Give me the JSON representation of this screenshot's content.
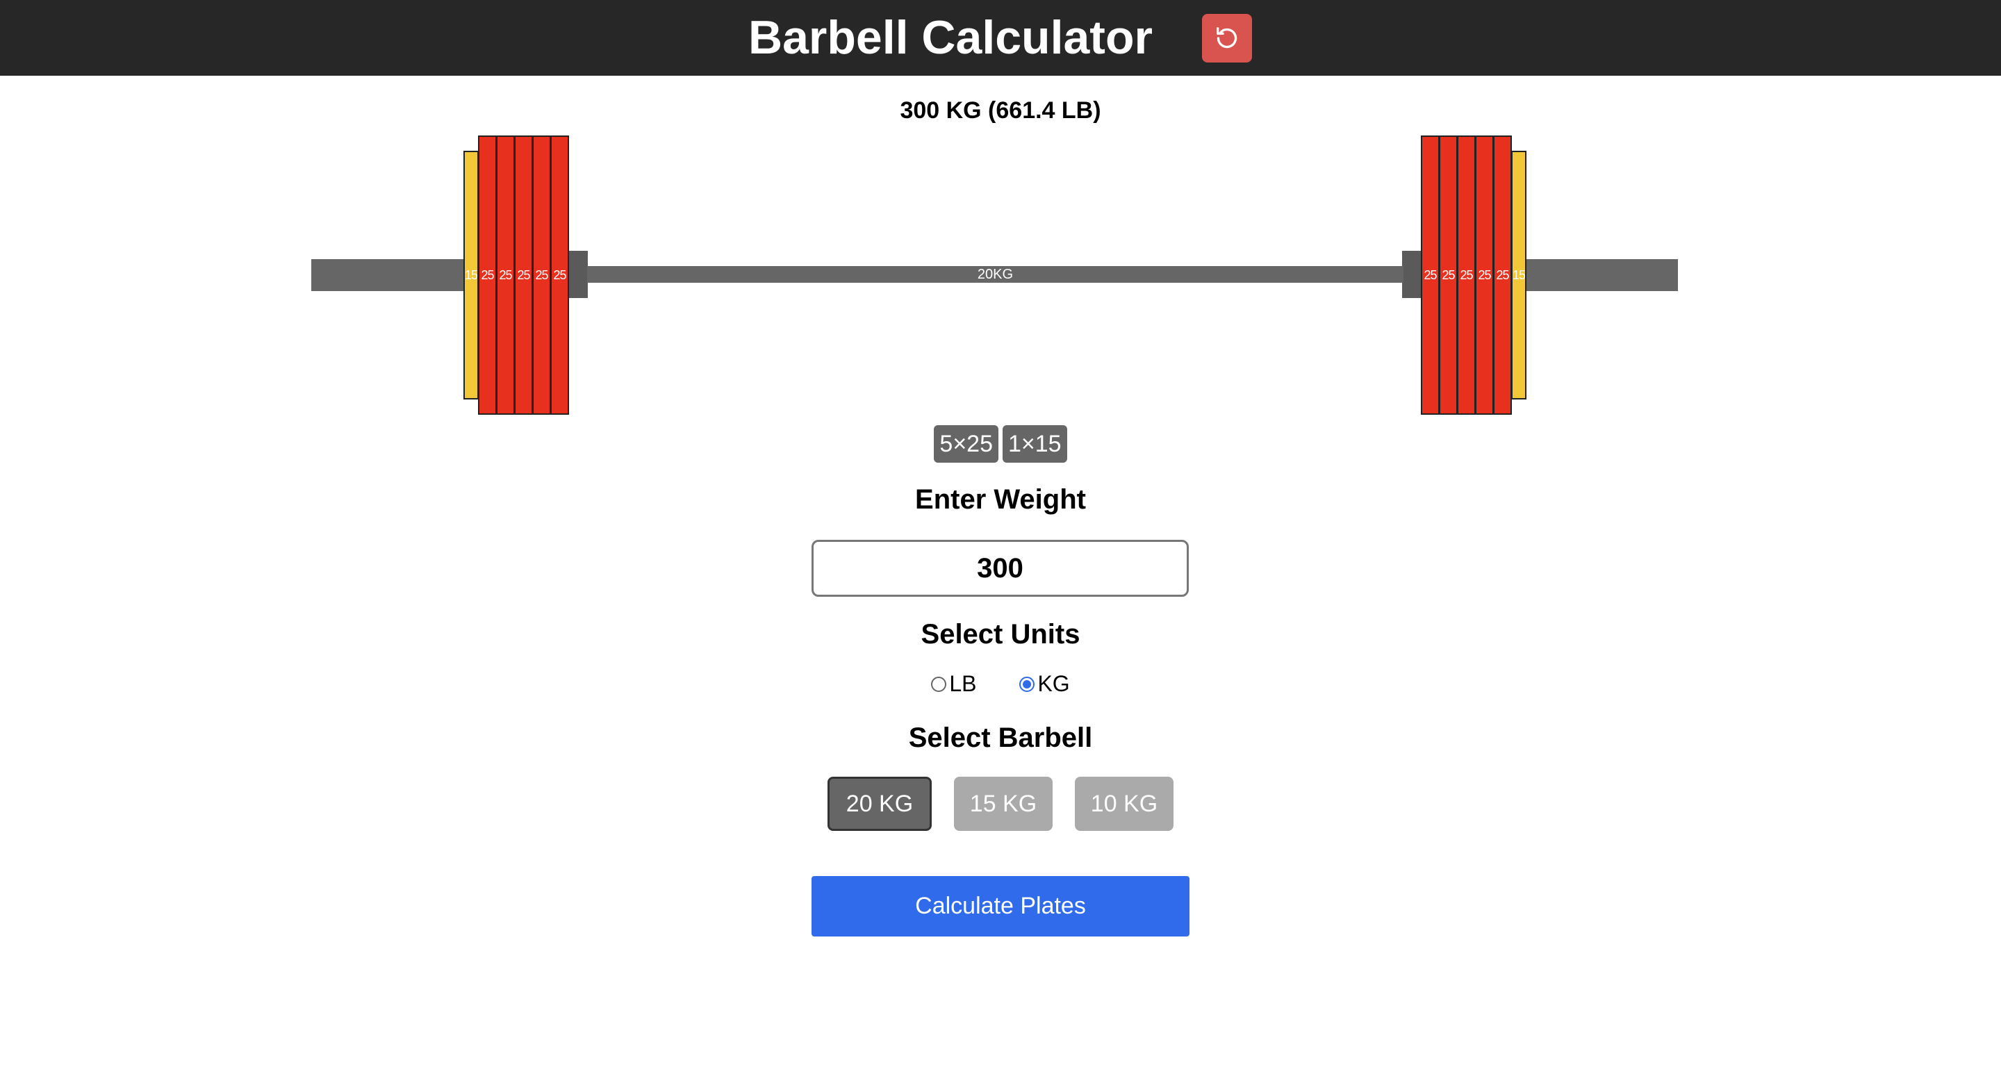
{
  "header": {
    "title": "Barbell Calculator",
    "reset_icon": "reset-icon",
    "reset_color": "#d9534f"
  },
  "barbell": {
    "total_label": "300 KG (661.4 LB)",
    "bar_label": "20KG",
    "left_plates": [
      "15",
      "25",
      "25",
      "25",
      "25",
      "25"
    ],
    "right_plates": [
      "25",
      "25",
      "25",
      "25",
      "25",
      "15"
    ]
  },
  "summary": {
    "chips": [
      "5×25",
      "1×15"
    ]
  },
  "weight": {
    "heading": "Enter Weight",
    "value": "300"
  },
  "units": {
    "heading": "Select Units",
    "options": [
      {
        "label": "LB",
        "selected": false
      },
      {
        "label": "KG",
        "selected": true
      }
    ]
  },
  "barbell_select": {
    "heading": "Select Barbell",
    "options": [
      {
        "label": "20 KG",
        "active": true
      },
      {
        "label": "15 KG",
        "active": false
      },
      {
        "label": "10 KG",
        "active": false
      }
    ]
  },
  "actions": {
    "calculate_label": "Calculate Plates",
    "accent_color": "#2f6bea"
  },
  "colors": {
    "header_bg": "#272727",
    "plate_25": "#e8301f",
    "plate_15": "#f2c839",
    "bar": "#666666"
  }
}
